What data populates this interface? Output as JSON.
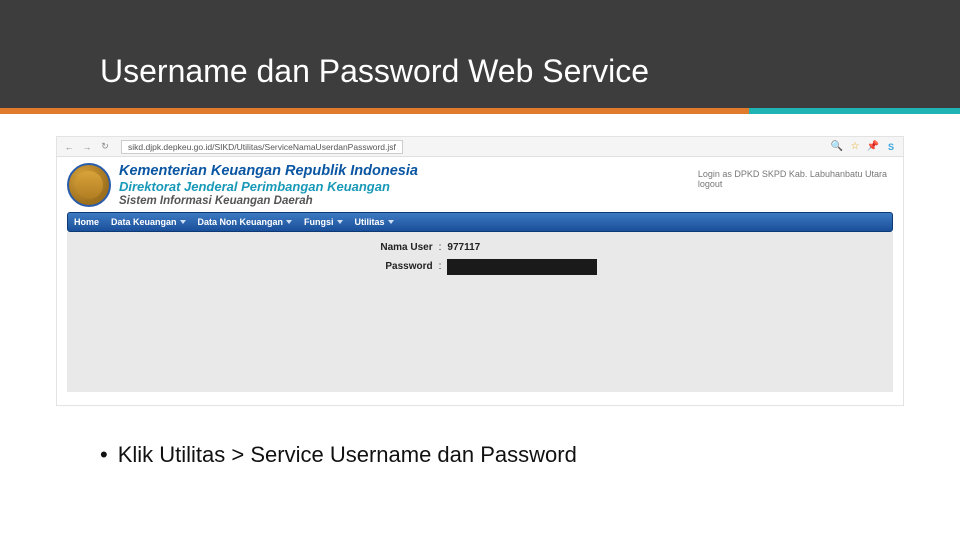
{
  "slide": {
    "title": "Username dan Password Web Service",
    "bullet": "Klik Utilitas > Service Username dan Password"
  },
  "browser": {
    "url": "sikd.djpk.depkeu.go.id/SIKD/Utilitas/ServiceNamaUserdanPassword.jsf"
  },
  "site": {
    "line1": "Kementerian Keuangan Republik Indonesia",
    "line2": "Direktorat Jenderal Perimbangan Keuangan",
    "line3": "Sistem Informasi Keuangan Daerah",
    "login_as": "Login as DPKD SKPD Kab. Labuhanbatu Utara",
    "logout": "logout"
  },
  "menu": {
    "home": "Home",
    "data_keuangan": "Data Keuangan",
    "data_non_keuangan": "Data Non Keuangan",
    "fungsi": "Fungsi",
    "utilitas": "Utilitas"
  },
  "fields": {
    "user_label": "Nama User",
    "user_value": "977117",
    "password_label": "Password"
  }
}
